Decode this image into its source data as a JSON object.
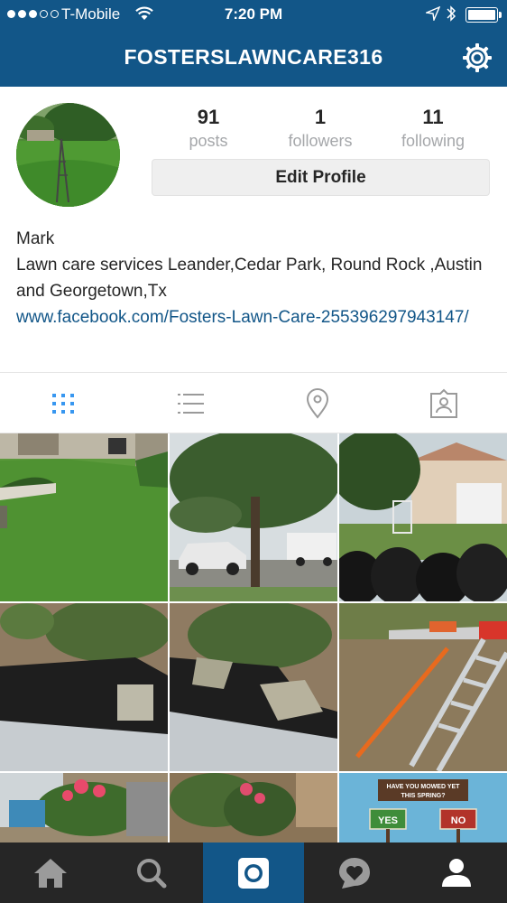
{
  "status_bar": {
    "carrier": "T-Mobile",
    "time": "7:20 PM",
    "icons": [
      "signal-dots-icon",
      "wifi-icon",
      "location-arrow-icon",
      "bluetooth-icon",
      "battery-icon"
    ]
  },
  "header": {
    "username": "FOSTERSLAWNCARE316",
    "settings_icon": "gear-icon"
  },
  "profile": {
    "stats": [
      {
        "value": "91",
        "label": "posts"
      },
      {
        "value": "1",
        "label": "followers"
      },
      {
        "value": "11",
        "label": "following"
      }
    ],
    "edit_button": "Edit Profile",
    "name": "Mark",
    "bio": "Lawn care services Leander,Cedar Park, Round Rock ,Austin and Georgetown,Tx",
    "website": "www.facebook.com/Fosters-Lawn-Care-255396297943147/"
  },
  "tabs": [
    {
      "icon": "grid-icon",
      "active": true
    },
    {
      "icon": "list-icon",
      "active": false
    },
    {
      "icon": "location-pin-icon",
      "active": false
    },
    {
      "icon": "tagged-photos-icon",
      "active": false
    }
  ],
  "grid_posts": {
    "sign_line1": "HAVE YOU MOWED YET",
    "sign_line2": "THIS SPRING?",
    "sign_yes": "YES",
    "sign_no": "NO"
  },
  "bottom_nav": [
    {
      "icon": "home-icon",
      "active": false
    },
    {
      "icon": "search-icon",
      "active": false
    },
    {
      "icon": "camera-icon",
      "active": true
    },
    {
      "icon": "activity-heart-icon",
      "active": false
    },
    {
      "icon": "profile-icon",
      "active": false
    }
  ],
  "colors": {
    "brand": "#125688",
    "nav_bg": "#262626",
    "muted": "#a5a7aa",
    "link": "#125688"
  }
}
